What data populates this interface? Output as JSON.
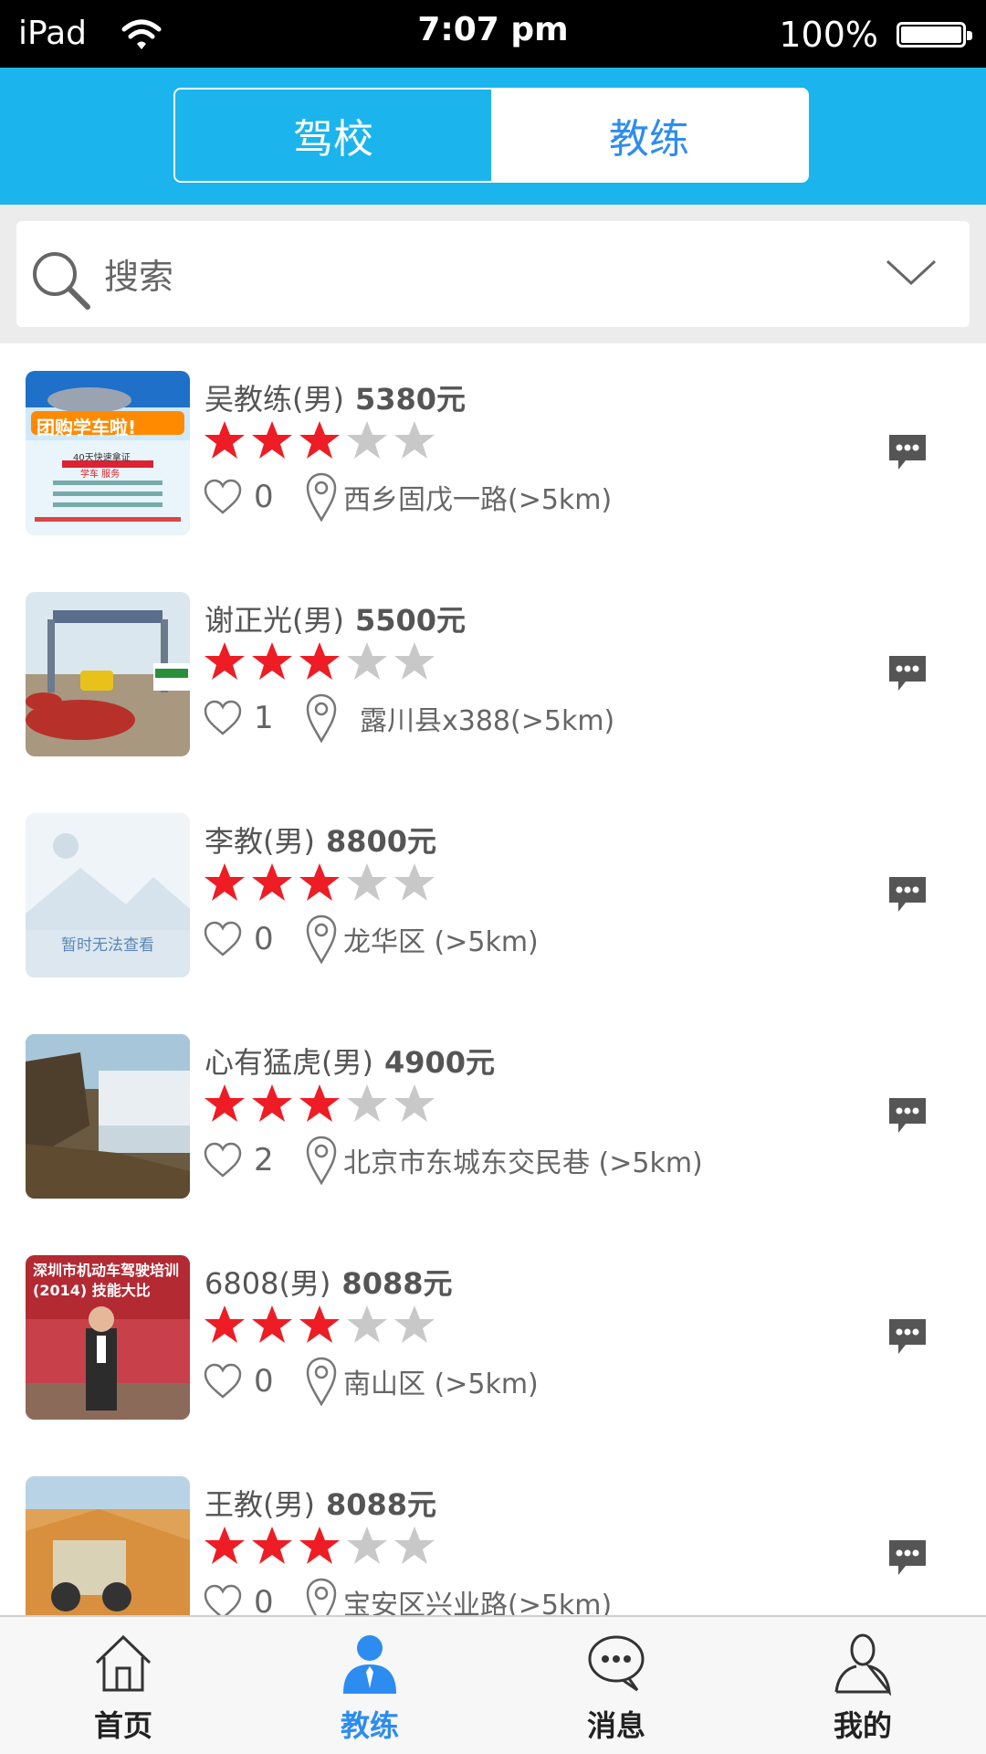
{
  "status_bar": {
    "device": "iPad",
    "time": "7:07 pm",
    "battery": "100%"
  },
  "header": {
    "tabs": [
      {
        "label": "驾校",
        "active": true
      },
      {
        "label": "教练",
        "active": false
      }
    ]
  },
  "search": {
    "placeholder": "搜索"
  },
  "coaches": [
    {
      "name": "吴教练(男)",
      "price": "5380元",
      "stars": 3,
      "likes": "0",
      "location": "西乡固戊一路(>5km)",
      "thumb": "driving-school-ad-image"
    },
    {
      "name": "谢正光(男)",
      "price": "5500元",
      "stars": 3,
      "likes": "1",
      "location": "露川县x388(>5km)",
      "thumb": "school-gate-image"
    },
    {
      "name": "李教(男)",
      "price": "8800元",
      "stars": 3,
      "likes": "0",
      "location": "龙华区 (>5km)",
      "thumb": "placeholder-image",
      "thumb_text": "暂时无法查看"
    },
    {
      "name": "心有猛虎(男)",
      "price": "4900元",
      "stars": 3,
      "likes": "2",
      "location": "北京市东城东交民巷 (>5km)",
      "thumb": "waterfall-image"
    },
    {
      "name": "6808(男)",
      "price": "8088元",
      "stars": 3,
      "likes": "0",
      "location": "南山区 (>5km)",
      "thumb": "competition-banner-image",
      "thumb_text": "深圳市机动车驾驶培训 (2014) 技能大比"
    },
    {
      "name": "王教(男)",
      "price": "8088元",
      "stars": 3,
      "likes": "0",
      "location": "宝安区兴业路(>5km)",
      "thumb": "desert-jeep-image"
    }
  ],
  "tab_bar": {
    "items": [
      {
        "label": "首页",
        "icon": "home-icon",
        "active": false
      },
      {
        "label": "教练",
        "icon": "coach-person-icon",
        "active": true
      },
      {
        "label": "消息",
        "icon": "message-icon",
        "active": false
      },
      {
        "label": "我的",
        "icon": "profile-icon",
        "active": false
      }
    ]
  },
  "colors": {
    "header": "#1bb4ec",
    "active_tab": "#2d8cf0",
    "star_on": "#ee1c24",
    "star_off": "#c8c8c8"
  },
  "promo": {
    "ad_title": "团购学车啦!",
    "ad_lines": [
      "40天快速拿证",
      "学车  服务"
    ]
  }
}
